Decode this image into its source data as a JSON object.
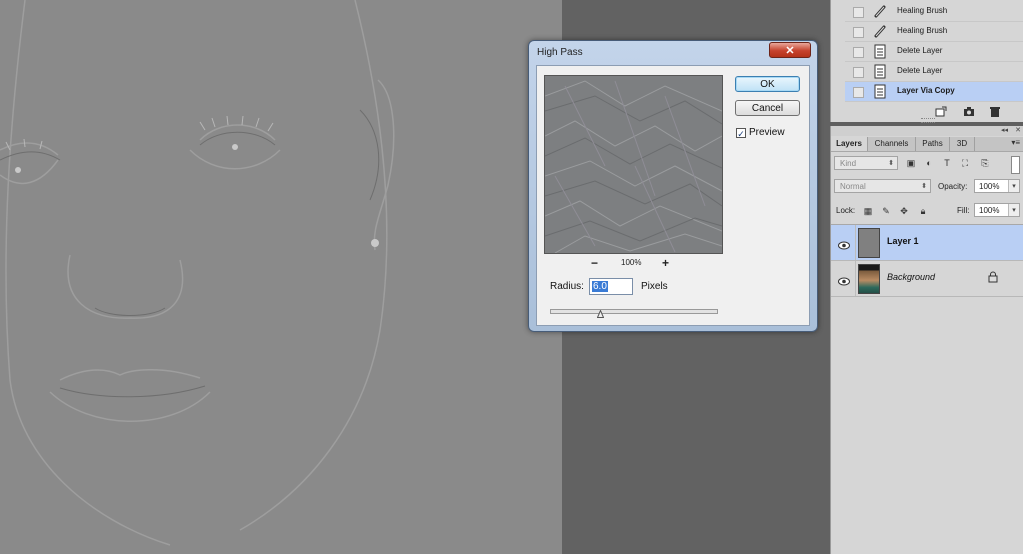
{
  "history": {
    "items": [
      {
        "label": "Healing Brush",
        "icon": "healing-brush-icon",
        "active": false
      },
      {
        "label": "Healing Brush",
        "icon": "healing-brush-icon",
        "active": false
      },
      {
        "label": "Delete Layer",
        "icon": "document-icon",
        "active": false
      },
      {
        "label": "Delete Layer",
        "icon": "document-icon",
        "active": false
      },
      {
        "label": "Layer Via Copy",
        "icon": "document-icon",
        "active": true
      }
    ]
  },
  "layers_panel": {
    "tabs": [
      "Layers",
      "Channels",
      "Paths",
      "3D"
    ],
    "active_tab": "Layers",
    "filter_kind": "Kind",
    "blend_mode": "Normal",
    "opacity_label": "Opacity:",
    "opacity": "100%",
    "lock_label": "Lock:",
    "fill_label": "Fill:",
    "fill": "100%",
    "layers": [
      {
        "name": "Layer 1",
        "selected": true,
        "visible": true,
        "locked": false
      },
      {
        "name": "Background",
        "selected": false,
        "visible": true,
        "locked": true
      }
    ]
  },
  "dialog": {
    "title": "High Pass",
    "close": "✕",
    "ok": "OK",
    "cancel": "Cancel",
    "preview_label": "Preview",
    "preview_checked": true,
    "zoom_minus": "−",
    "zoom": "100%",
    "zoom_plus": "+",
    "radius_label": "Radius:",
    "radius_value": "6.0",
    "radius_unit": "Pixels",
    "slider_level": 0.3
  },
  "colors": {
    "selection": "#b9cff4",
    "image_gray": "#8a8a8a",
    "workspace": "#626262",
    "close_red": "#c6422d"
  }
}
